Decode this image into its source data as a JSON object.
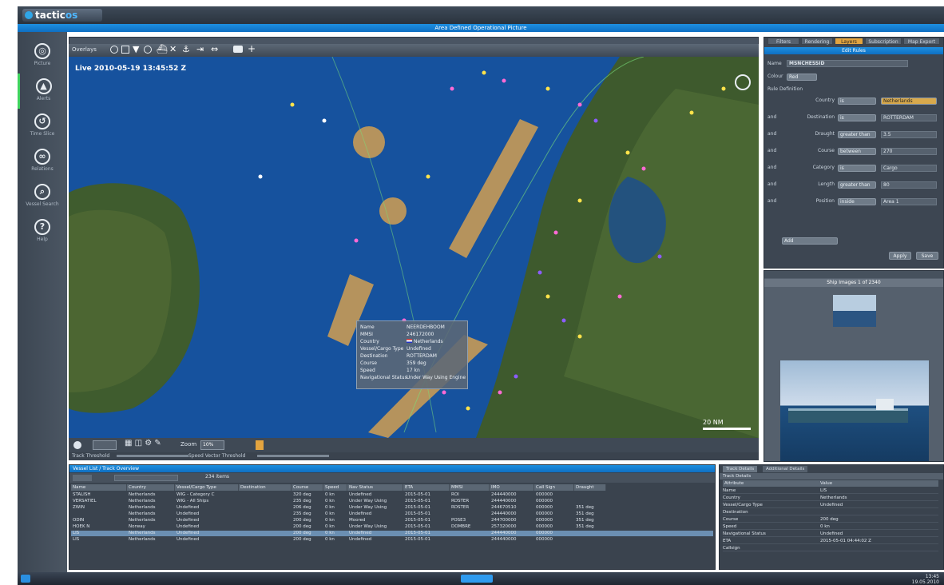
{
  "app": {
    "logo_text_1": "tactic",
    "logo_text_2": "os",
    "window_title": "Area Defined Operational Picture"
  },
  "leftnav": {
    "items": [
      {
        "glyph": "◎",
        "label": "Picture",
        "icon": "globe-icon"
      },
      {
        "glyph": "▲",
        "label": "Alerts",
        "icon": "alarm-icon"
      },
      {
        "glyph": "↺",
        "label": "Time Slice",
        "icon": "history-icon"
      },
      {
        "glyph": "∞",
        "label": "Relations",
        "icon": "link-icon"
      },
      {
        "glyph": "⌕",
        "label": "Vessel Search",
        "icon": "search-icon"
      },
      {
        "glyph": "?",
        "label": "Help",
        "icon": "help-icon"
      }
    ]
  },
  "map": {
    "toolbar_label": "Overlays",
    "timestamp": "Live 2010-05-19 13:45:52 Z",
    "scale_label": "20 NM",
    "zoom_label": "Zoom",
    "zoom_value": "10%",
    "slider_left": "Track Threshold",
    "slider_right": "Speed Vector Threshold"
  },
  "tooltip": {
    "rows": [
      {
        "k": "Name",
        "v": "NEERDEHBOOM"
      },
      {
        "k": "MMSI",
        "v": "246172000"
      },
      {
        "k": "Country",
        "v": "Netherlands"
      },
      {
        "k": "Vessel/Cargo Type",
        "v": "Undefined"
      },
      {
        "k": "Destination",
        "v": "ROTTERDAM"
      },
      {
        "k": "Course",
        "v": "359 deg"
      },
      {
        "k": "Speed",
        "v": "17 kn"
      },
      {
        "k": "Navigational Status",
        "v": "Under Way Using Engine"
      }
    ]
  },
  "rightpanel": {
    "tabs": [
      "Filters",
      "Rendering",
      "Layers",
      "Subscription",
      "Map Export"
    ],
    "edit_header": "Edit Rules",
    "name_label": "Name",
    "name_value": "MSNCHESSID",
    "color_label": "Colour",
    "color_value": "Red",
    "section_label": "Rule Definition",
    "rules": [
      {
        "prefix": "",
        "label": "Country",
        "op": "is",
        "value": "Netherlands"
      },
      {
        "prefix": "and",
        "label": "Destination",
        "op": "is",
        "value": "ROTTERDAM"
      },
      {
        "prefix": "and",
        "label": "Draught",
        "op": "greater than",
        "value": "3.5"
      },
      {
        "prefix": "and",
        "label": "Course",
        "op": "between",
        "value": "270"
      },
      {
        "prefix": "and",
        "label": "Category",
        "op": "is",
        "value": "Cargo"
      },
      {
        "prefix": "and",
        "label": "Length",
        "op": "greater than",
        "value": "80"
      },
      {
        "prefix": "and",
        "label": "Position",
        "op": "inside",
        "value": "Area 1"
      }
    ],
    "add_label": "Add",
    "apply_label": "Apply",
    "save_label": "Save"
  },
  "photo": {
    "header": "Ship Images 1 of 2340"
  },
  "table": {
    "header": "Vessel List / Track Overview",
    "filter_placeholder": "Filter",
    "count": "234 items",
    "columns": [
      "Name",
      "Country",
      "Vessel/Cargo Type",
      "Destination",
      "Course",
      "Speed",
      "Nav Status",
      "ETA",
      "MMSI",
      "IMO",
      "Call Sign",
      "Draught"
    ],
    "rows": [
      [
        "STALISH",
        "Netherlands",
        "WIG - Category C",
        "",
        "320 deg",
        "0 kn",
        "Undefined",
        "2015-05-01",
        "ROI",
        "244440000",
        "000000",
        ""
      ],
      [
        "VERSATIEL",
        "Netherlands",
        "WIG - All Ships",
        "",
        "235 deg",
        "0 kn",
        "Under Way Using",
        "2015-05-01",
        "RDSTER",
        "244440000",
        "000000",
        ""
      ],
      [
        "ZWIN",
        "Netherlands",
        "Undefined",
        "",
        "206 deg",
        "0 kn",
        "Under Way Using",
        "2015-05-01",
        "RDSTER",
        "244670510",
        "000000",
        "351 deg"
      ],
      [
        "",
        "Netherlands",
        "Undefined",
        "",
        "235 deg",
        "0 kn",
        "Undefined",
        "2015-05-01",
        "",
        "244440000",
        "000000",
        "351 deg"
      ],
      [
        "ODIN",
        "Netherlands",
        "Undefined",
        "",
        "200 deg",
        "0 kn",
        "Moored",
        "2015-05-01",
        "POSE3",
        "244700000",
        "000000",
        "351 deg"
      ],
      [
        "HOEK N",
        "Norway",
        "Undefined",
        "",
        "200 deg",
        "0 kn",
        "Under Way Using",
        "2015-05-01",
        "DOMBRE",
        "257320000",
        "000000",
        "351 deg"
      ],
      [
        "LIS",
        "Netherlands",
        "Undefined",
        "",
        "200 deg",
        "0 kn",
        "Undefined",
        "2015-05-01",
        "",
        "244440000",
        "000000",
        ""
      ],
      [
        "LIS",
        "Netherlands",
        "Undefined",
        "",
        "200 deg",
        "0 kn",
        "Undefined",
        "2015-05-01",
        "",
        "244440000",
        "000000",
        ""
      ]
    ],
    "selected_row": 6
  },
  "details": {
    "tabs": [
      "Track Details",
      "Additional Details"
    ],
    "header": "Track Details",
    "col_attr": "Attribute",
    "col_val": "Value",
    "rows": [
      {
        "k": "Name",
        "v": "LIS"
      },
      {
        "k": "Country",
        "v": "Netherlands"
      },
      {
        "k": "Vessel/Cargo Type",
        "v": "Undefined"
      },
      {
        "k": "Destination",
        "v": ""
      },
      {
        "k": "Course",
        "v": "200 deg"
      },
      {
        "k": "Speed",
        "v": "0 kn"
      },
      {
        "k": "Navigational Status",
        "v": "Undefined"
      },
      {
        "k": "ETA",
        "v": "2015-05-01 04:44:02 Z"
      },
      {
        "k": "Callsign",
        "v": ""
      }
    ]
  },
  "taskbar": {
    "clock": "13:45",
    "date": "19.05.2010"
  },
  "colors": {
    "accent": "#1d8fe0",
    "sea": "#16529e",
    "land": "#3d5a2c",
    "zone": "#c79a55"
  }
}
